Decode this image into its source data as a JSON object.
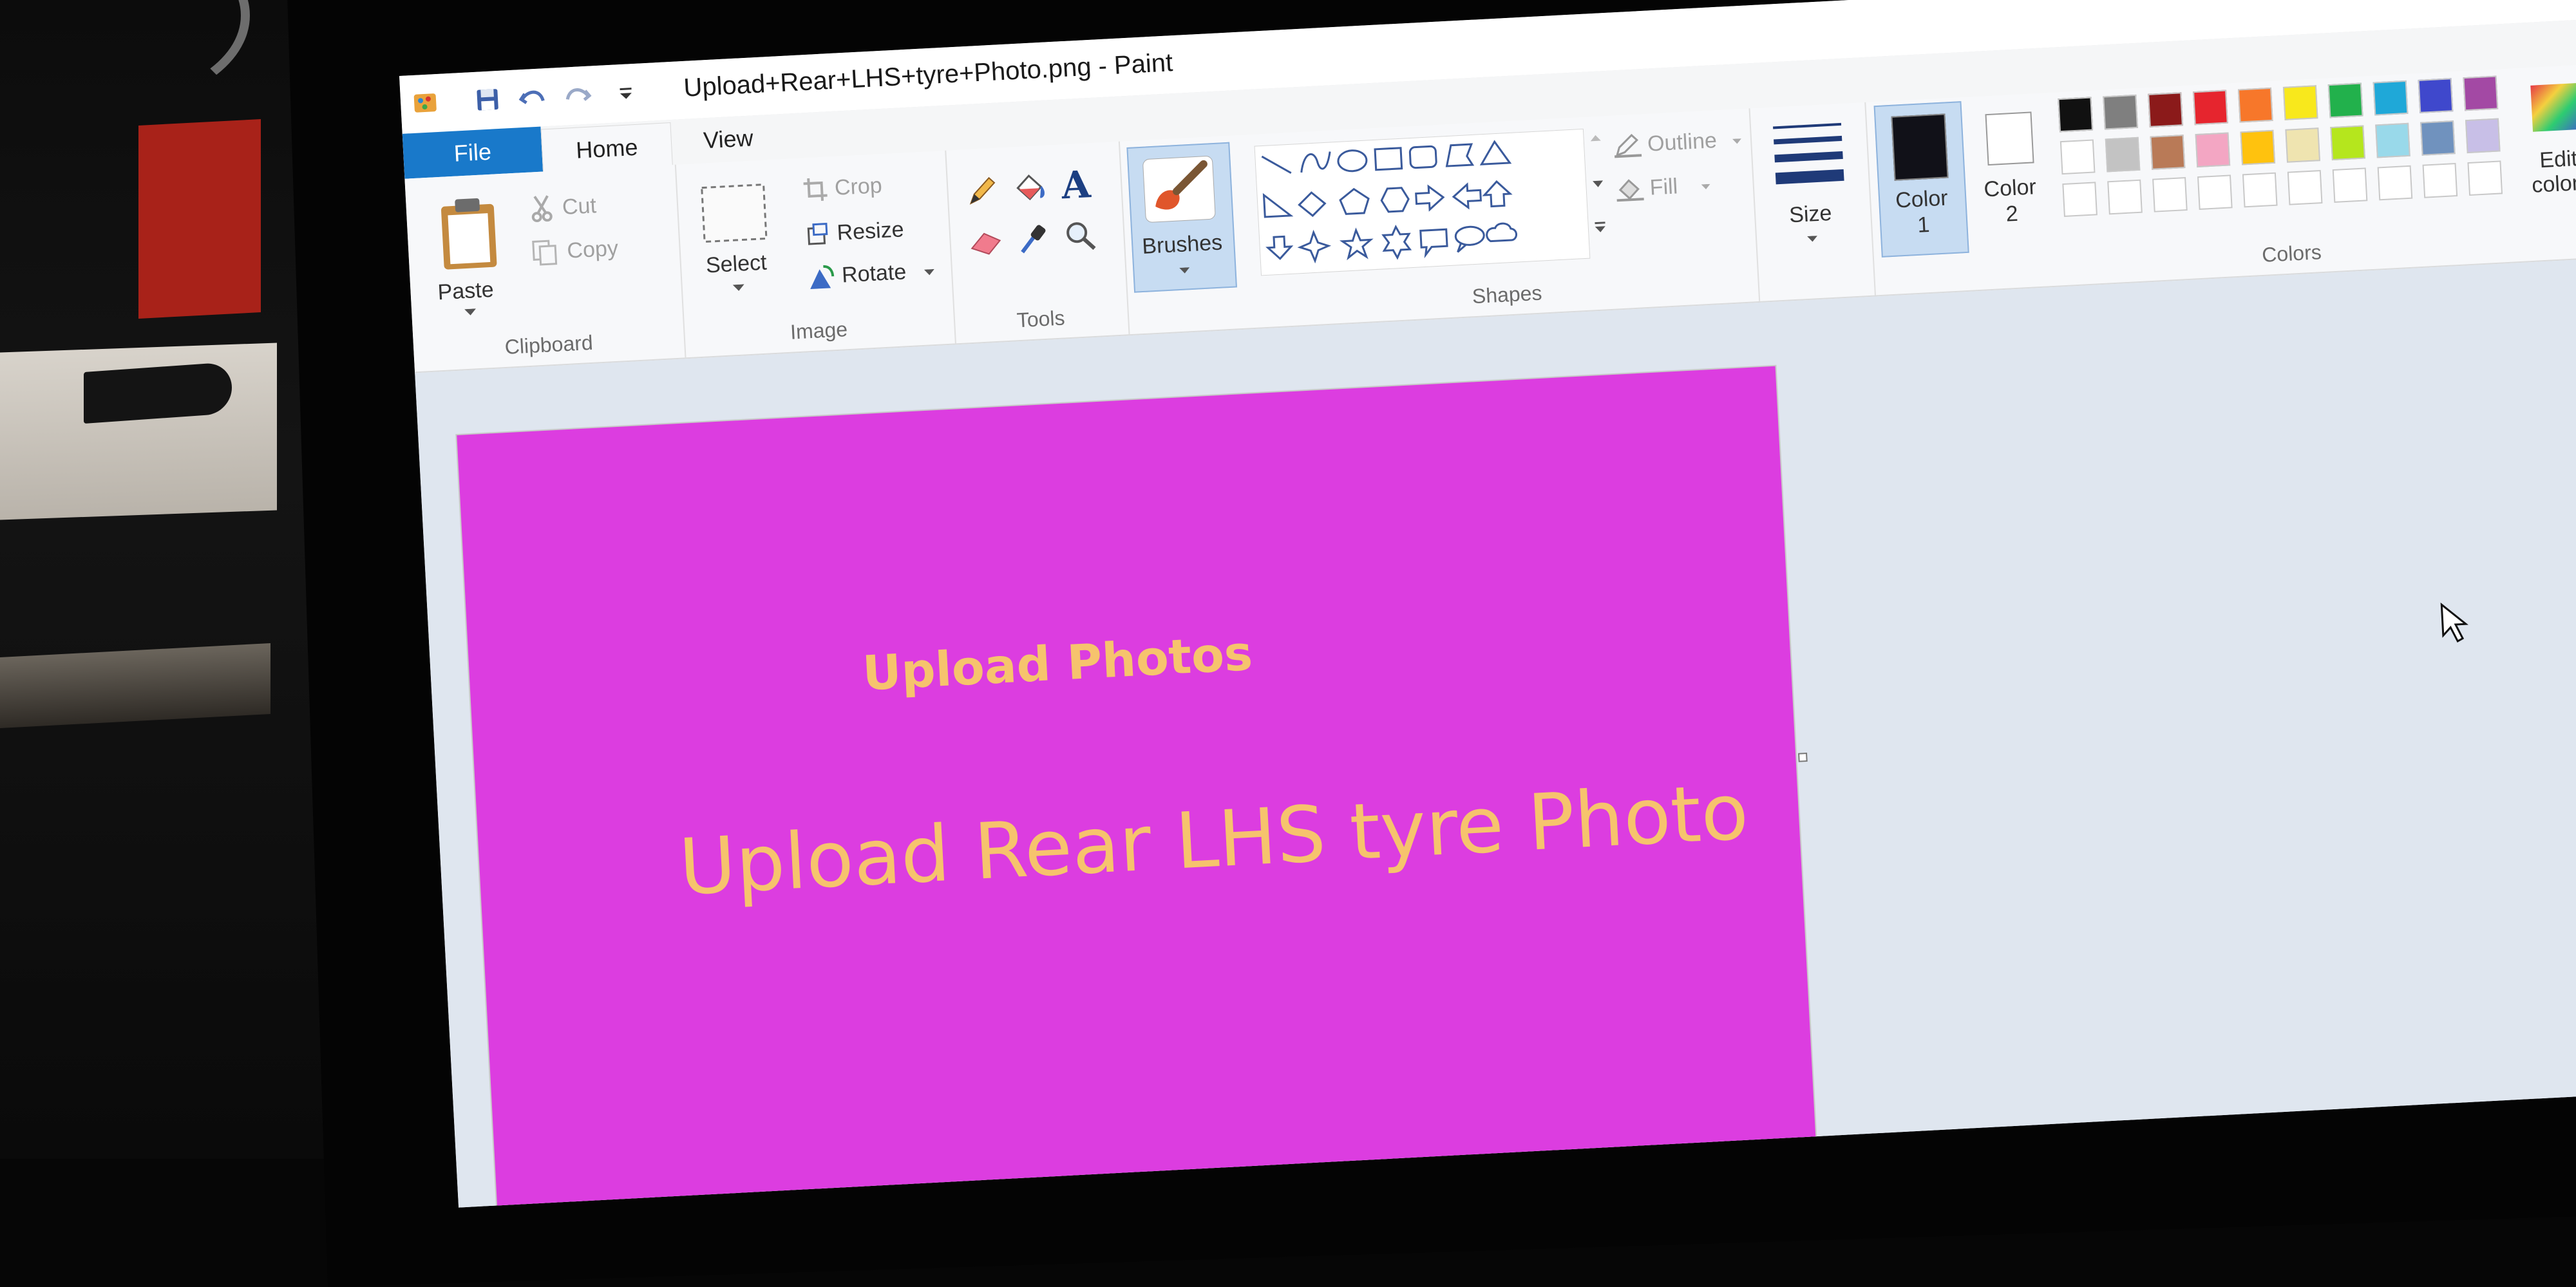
{
  "window": {
    "title": "Upload+Rear+LHS+tyre+Photo.png - Paint"
  },
  "quick_access": {
    "icons": [
      "paint-app-icon",
      "save-icon",
      "undo-icon",
      "redo-icon",
      "customize-quick-access-icon"
    ]
  },
  "tabs": {
    "file": "File",
    "home": "Home",
    "view": "View"
  },
  "clipboard": {
    "paste": "Paste",
    "cut": "Cut",
    "copy": "Copy",
    "group_label": "Clipboard"
  },
  "image": {
    "select": "Select",
    "crop": "Crop",
    "resize": "Resize",
    "rotate": "Rotate",
    "group_label": "Image"
  },
  "tools": {
    "group_label": "Tools",
    "text_tool_glyph": "A"
  },
  "brushes": {
    "label": "Brushes"
  },
  "shapes": {
    "outline": "Outline",
    "fill": "Fill",
    "group_label": "Shapes"
  },
  "size": {
    "label": "Size"
  },
  "color1": {
    "line1": "Color",
    "line2": "1",
    "value": "#111118"
  },
  "color2": {
    "line1": "Color",
    "line2": "2",
    "value": "#ffffff"
  },
  "colors": {
    "group_label": "Colors",
    "edit_line1": "Edit",
    "edit_line2": "colors",
    "row1": [
      "#111111",
      "#7f7f7f",
      "#8b1a1a",
      "#e6252e",
      "#f7772a",
      "#f8e81c",
      "#22b14c",
      "#1fa8d8",
      "#3f48cc",
      "#a349a4"
    ],
    "row2": [
      "#ffffff",
      "#c3c3c3",
      "#b97a57",
      "#f3a6c3",
      "#ffc20e",
      "#efe4b0",
      "#b5e61d",
      "#99d9ea",
      "#7092be",
      "#c8bfe7"
    ],
    "row3": [
      "#ffffff",
      "#ffffff",
      "#ffffff",
      "#ffffff",
      "#ffffff",
      "#ffffff",
      "#ffffff",
      "#ffffff",
      "#ffffff",
      "#ffffff"
    ]
  },
  "canvas": {
    "background": "#dc3de0",
    "text_color": "#f6c36d",
    "heading": "Upload Photos",
    "subheading": "Upload Rear LHS tyre Photo"
  }
}
